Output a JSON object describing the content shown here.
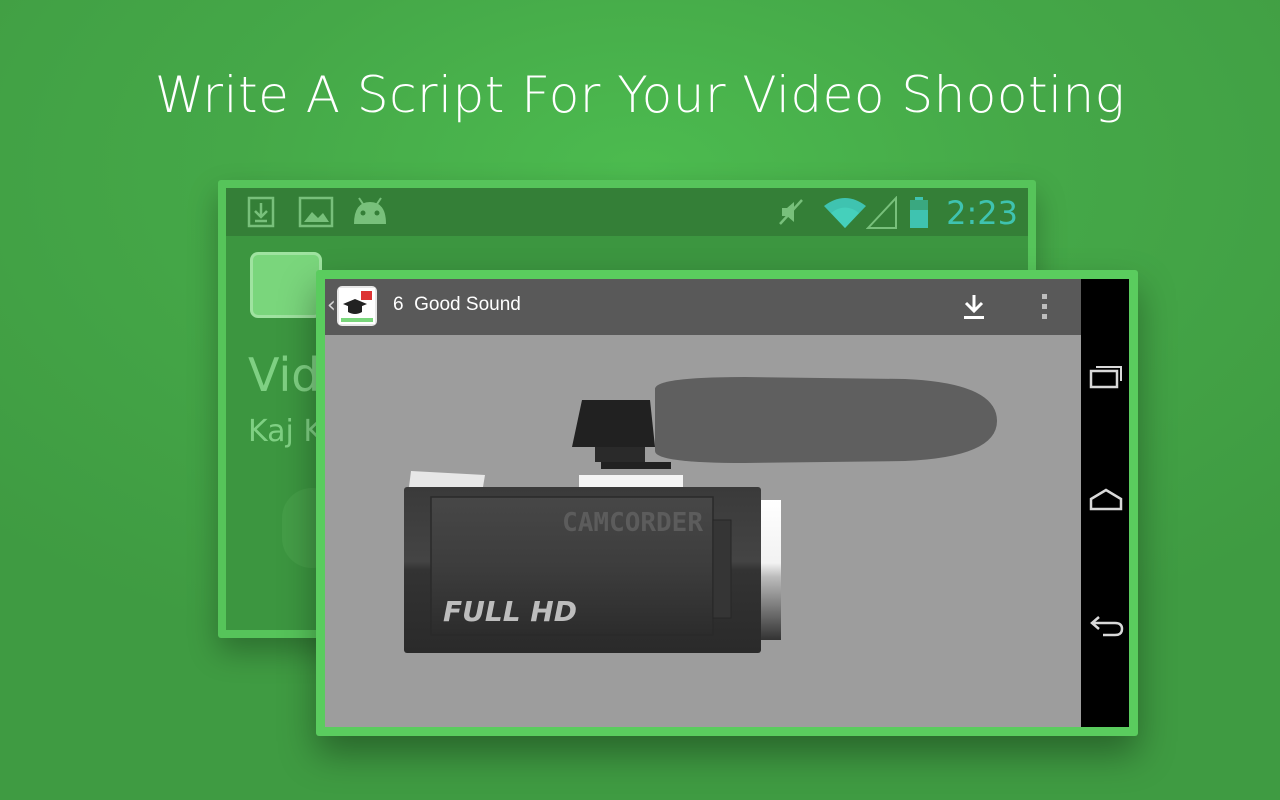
{
  "headline": "Write A Script For Your Video Shooting",
  "back_phone": {
    "status_time": "2:23",
    "status_icons": [
      "download-notification-icon",
      "image-notification-icon",
      "android-icon",
      "mute-icon",
      "wifi-icon",
      "signal-icon",
      "battery-icon"
    ],
    "title_partial": "Vid",
    "subtitle_partial": "Kaj K"
  },
  "front_phone": {
    "back_glyph": "‹",
    "lesson_number": "6",
    "lesson_title": "Good Sound",
    "actions": [
      "download-icon",
      "overflow-menu-icon"
    ],
    "video": {
      "camera_brand_text": "CAMCORDER",
      "camera_model_text": "FULL HD"
    },
    "nav_buttons": [
      "recent-apps-icon",
      "home-icon",
      "back-icon"
    ]
  },
  "colors": {
    "background": "#45a848",
    "frame": "#5acc5e",
    "action_bar": "#595959",
    "video_bg": "#9d9d9d",
    "status_time": "#3fc3b0"
  }
}
